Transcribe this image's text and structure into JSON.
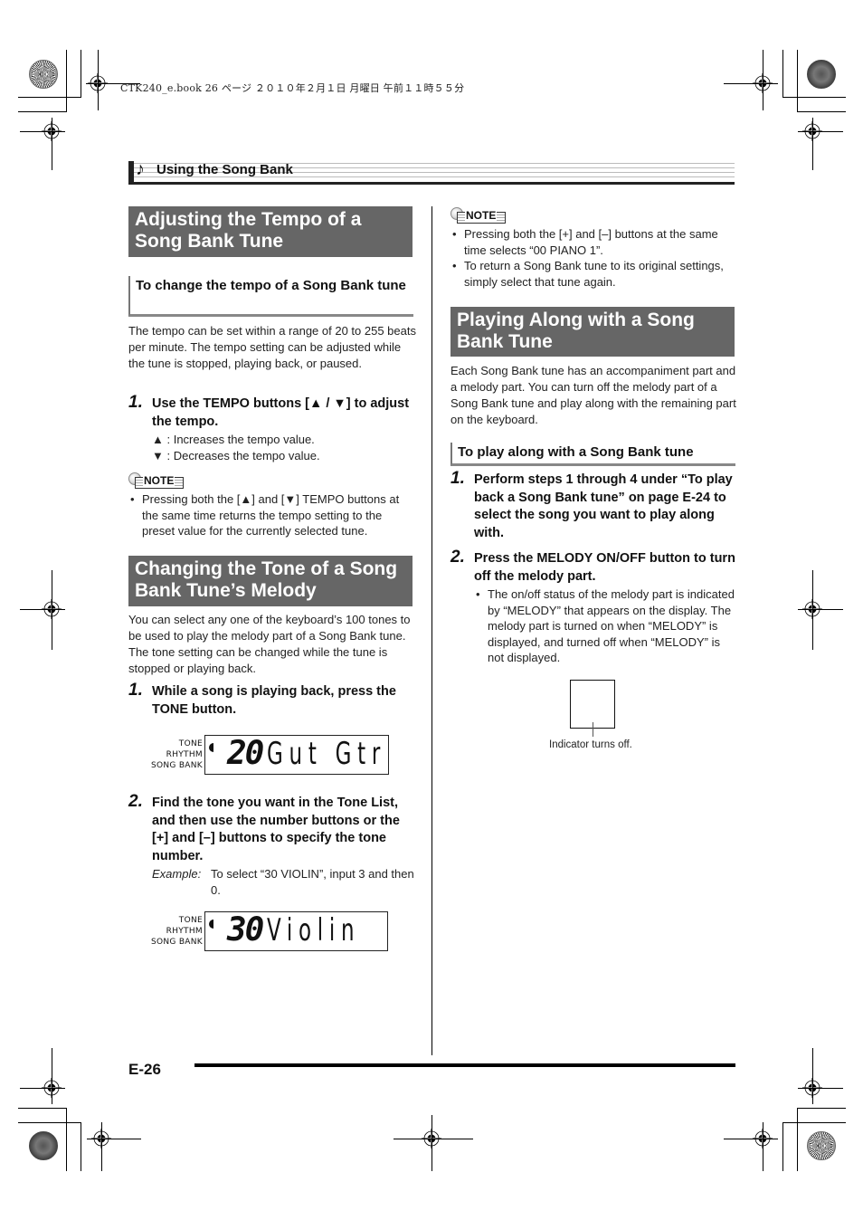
{
  "print_header": {
    "file_info": "CTK240_e.book  26 ページ  ２０１０年２月１日  月曜日  午前１１時５５分"
  },
  "section": {
    "title": "Using the Song Bank",
    "icon": "music-note-icon"
  },
  "left_column": {
    "tempo": {
      "heading": "Adjusting the Tempo of a Song Bank Tune",
      "subhead": "To change the tempo of a Song Bank tune",
      "intro": "The tempo can be set within a range of 20 to 255 beats per minute. The tempo setting can be adjusted while the tune is stopped, playing back, or paused.",
      "steps": [
        {
          "num": "1.",
          "text": "Use the TEMPO buttons [▲ / ▼] to adjust the tempo.",
          "details": [
            "▲ : Increases the tempo value.",
            "▼ : Decreases the tempo value."
          ]
        }
      ],
      "note_label": "NOTE",
      "notes": [
        "Pressing both the [▲] and [▼] TEMPO buttons at the same time returns the tempo setting to the preset value for the currently selected tune."
      ]
    },
    "tone": {
      "heading": "Changing the Tone of a Song Bank Tune’s Melody",
      "intro": "You can select any one of the keyboard’s 100 tones to be used to play the melody part of a Song Bank tune. The tone setting can be changed while the tune is stopped or playing back.",
      "steps": [
        {
          "num": "1.",
          "text": "While a song is playing back, press the TONE button."
        },
        {
          "num": "2.",
          "text": "Find the tone you want in the Tone List, and then use the number buttons or the [+] and [–] buttons to specify the tone number.",
          "example_label": "Example:",
          "example_text": "To select “30 VIOLIN”, input 3 and then 0."
        }
      ],
      "displays": [
        {
          "labels": [
            "TONE",
            "RHYTHM",
            "SONG BANK"
          ],
          "number": "20",
          "name": "Gut Gtr"
        },
        {
          "labels": [
            "TONE",
            "RHYTHM",
            "SONG BANK"
          ],
          "number": "30",
          "name": "Violin"
        }
      ]
    }
  },
  "right_column": {
    "note_label": "NOTE",
    "notes": [
      "Pressing both the [+] and [–] buttons at the same time selects “00 PIANO 1”.",
      "To return a Song Bank tune to its original settings, simply select that tune again."
    ],
    "playalong": {
      "heading": "Playing Along with a Song Bank Tune",
      "intro": "Each Song Bank tune has an accompaniment part and a melody part. You can turn off the melody part of a Song Bank tune and play along with the remaining part on the keyboard.",
      "subhead": "To play along with a Song Bank tune",
      "steps": [
        {
          "num": "1.",
          "text": "Perform steps 1 through 4 under “To play back a Song Bank tune” on page E-24 to select the song you want to play along with."
        },
        {
          "num": "2.",
          "text": "Press the MELODY ON/OFF button to turn off the melody part.",
          "bullets": [
            "The on/off status of the melody part is indicated by “MELODY” that appears on the display. The melody part is turned on when “MELODY” is displayed, and turned off when “MELODY” is not displayed."
          ]
        }
      ],
      "indicator_caption": "Indicator turns off."
    }
  },
  "footer": {
    "page_number": "E-26"
  }
}
